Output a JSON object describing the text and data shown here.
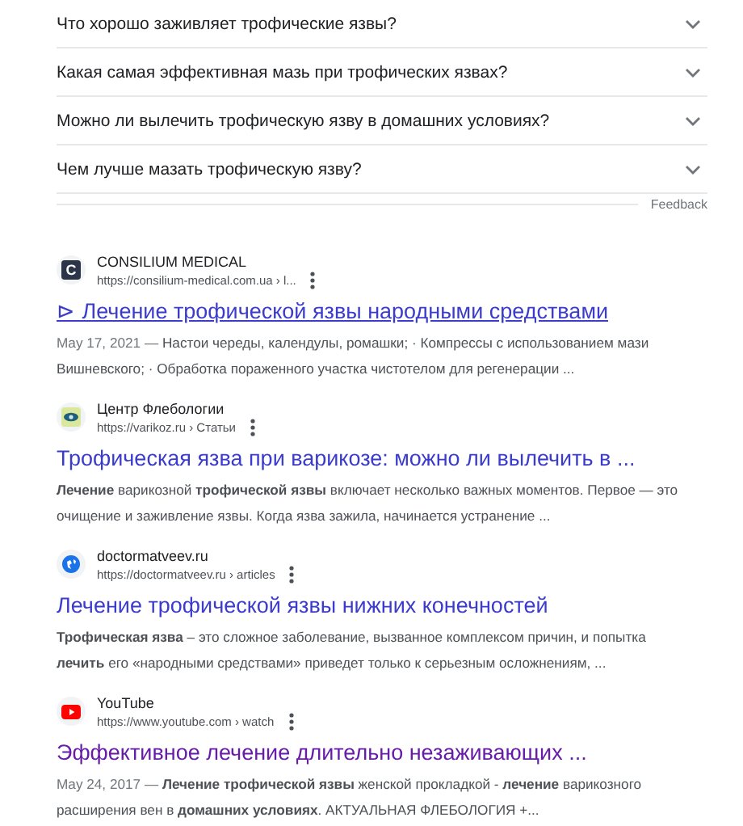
{
  "questions": [
    {
      "text": "Что хорошо заживляет трофические язвы?",
      "expanded": false
    },
    {
      "text": "Какая самая эффективная мазь при трофических язвах?",
      "expanded": false
    },
    {
      "text": "Можно ли вылечить трофическую язву в домашних условиях?",
      "expanded": false
    },
    {
      "text": "Чем лучше мазать трофическую язву?",
      "expanded": false
    }
  ],
  "feedback": "Feedback",
  "results": [
    {
      "kind": "letter",
      "favicon_letter": "C",
      "site": "CONSILIUM MEDICAL",
      "url": "https://consilium-medical.com.ua › l...",
      "title": "⊳ Лечение трофической язвы народными средствами",
      "visited": false,
      "hovered": true,
      "date": "May 17, 2021 —",
      "snippet": "Настои череды, календулы, ромашки; · Компрессы с использованием мази Вишневского; · Обработка пораженного участка чистотелом для регенерации ..."
    },
    {
      "kind": "eye",
      "site": "Центр Флебологии",
      "url": "https://varikoz.ru › Статьи",
      "title": "Трофическая язва при варикозе: можно ли вылечить в ...",
      "visited": false,
      "hovered": false,
      "snippet": "**Лечение** варикозной **трофической язвы** включает несколько важных моментов. Первое — это очищение и заживление язвы. Когда язва зажила, начинается устранение ..."
    },
    {
      "kind": "globe",
      "site": "doctormatveev.ru",
      "url": "https://doctormatveev.ru › articles",
      "title": "Лечение трофической язвы нижних конечностей",
      "visited": false,
      "hovered": false,
      "snippet": "**Трофическая язва** – это сложное заболевание, вызванное комплексом причин, и попытка **лечить** его «народными средствами» приведет только к серьезным осложнениям, ..."
    },
    {
      "kind": "play",
      "site": "YouTube",
      "url": "https://www.youtube.com › watch",
      "title": "Эффективное лечение длительно незаживающих ...",
      "visited": true,
      "hovered": false,
      "date": "May 24, 2017 —",
      "snippet": "**Лечение трофической язвы** женской прокладкой - **лечение** варикозного расширения вен в **домашних условиях**. АКТУАЛЬНАЯ ФЛЕБОЛОГИЯ +..."
    }
  ]
}
